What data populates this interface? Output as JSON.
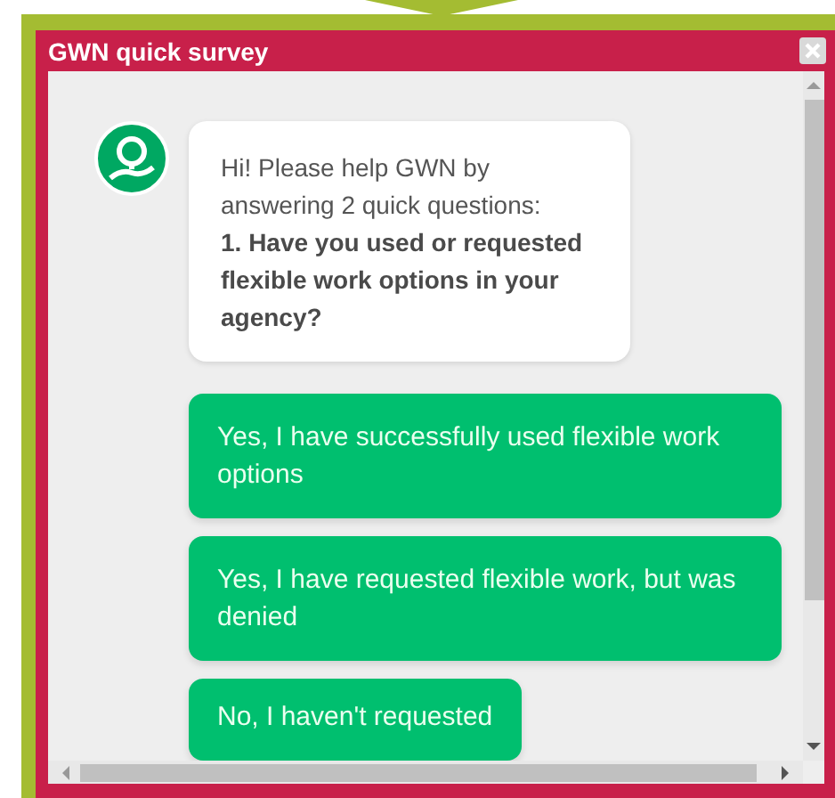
{
  "window": {
    "title": "GWN quick survey"
  },
  "message": {
    "intro": "Hi! Please help GWN by answering 2 quick questions:",
    "question": "1. Have you used or requested flexible work options in your agency?"
  },
  "options": [
    {
      "label": "Yes, I have successfully used flexible work options"
    },
    {
      "label": "Yes, I have requested flexible work, but was denied"
    },
    {
      "label": "No, I haven't requested"
    }
  ]
}
